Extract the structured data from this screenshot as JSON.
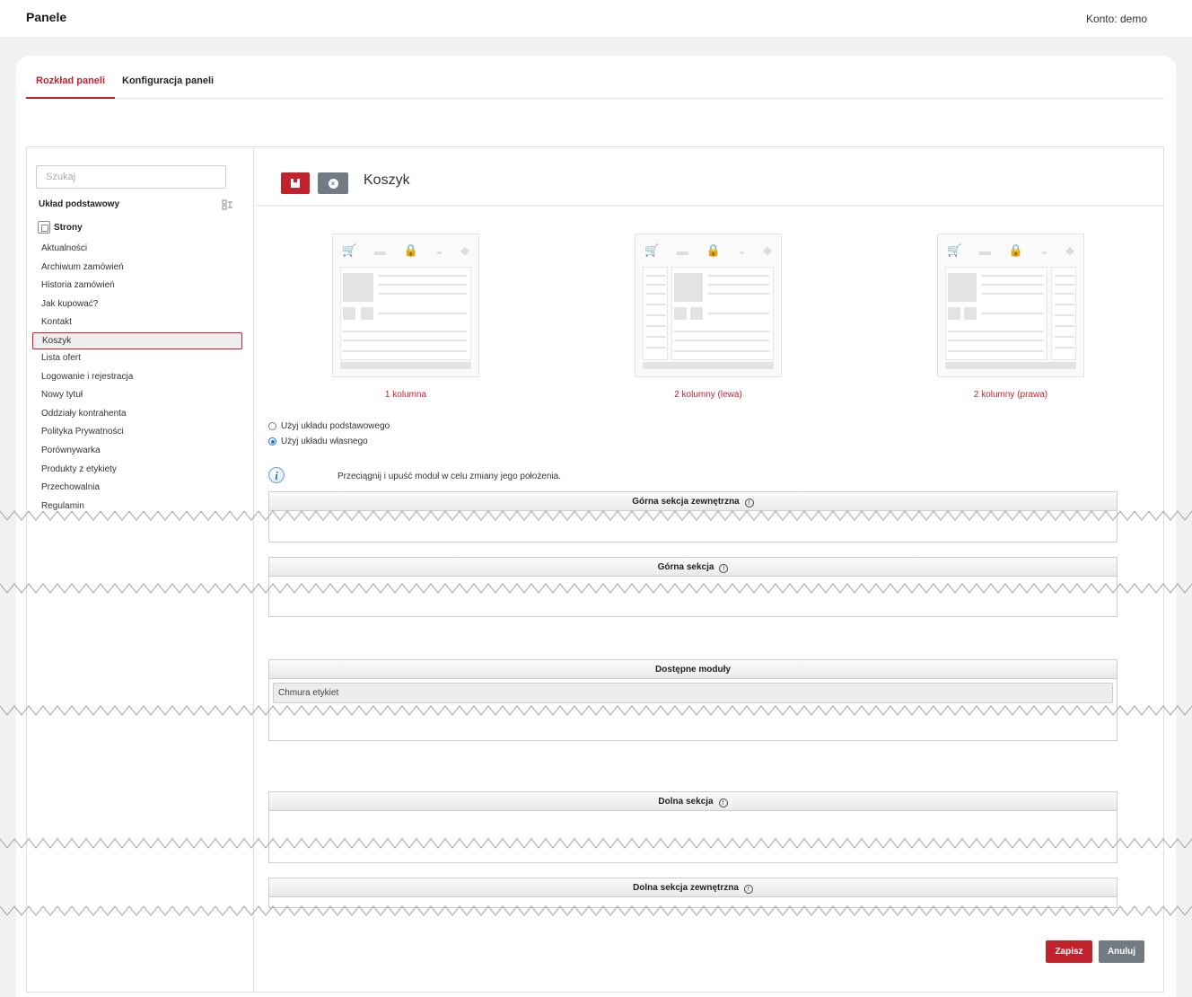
{
  "header": {
    "title": "Panele",
    "account": "Konto: demo"
  },
  "tabs": [
    {
      "label": "Rozkład paneli",
      "active": true
    },
    {
      "label": "Konfiguracja paneli",
      "active": false
    }
  ],
  "sidebar": {
    "search_placeholder": "Szukaj",
    "base_layout": "Układ podstawowy",
    "group": "Strony",
    "pages": [
      "Aktualności",
      "Archiwum zamówień",
      "Historia zamówień",
      "Jak kupować?",
      "Kontakt",
      "Koszyk",
      "Lista ofert",
      "Logowanie i rejestracja",
      "Nowy tytuł",
      "Oddziały kontrahenta",
      "Polityka Prywatności",
      "Porównywarka",
      "Produkty z etykiety",
      "Przechowalnia",
      "Regulamin"
    ],
    "selected": "Koszyk"
  },
  "main": {
    "panel_name": "Koszyk",
    "layouts": [
      "1 kolumna",
      "2 kolumny (lewa)",
      "2 kolumny (prawa)"
    ],
    "radio_base": "Użyj układu podstawowego",
    "radio_custom": "Użyj układu własnego",
    "radio_selected": "custom",
    "info": "Przeciągnij i upuść moduł w celu zmiany jego położenia.",
    "sections": {
      "top_outer": "Górna sekcja zewnętrzna",
      "top": "Górna sekcja",
      "available": "Dostępne moduły",
      "bottom": "Dolna sekcja",
      "bottom_outer": "Dolna sekcja zewnętrzna"
    },
    "available_modules": [
      "Chmura etykiet"
    ],
    "save_label": "Zapisz",
    "cancel_label": "Anuluj"
  },
  "colors": {
    "accent": "#c0222e",
    "secondary": "#727b84"
  }
}
